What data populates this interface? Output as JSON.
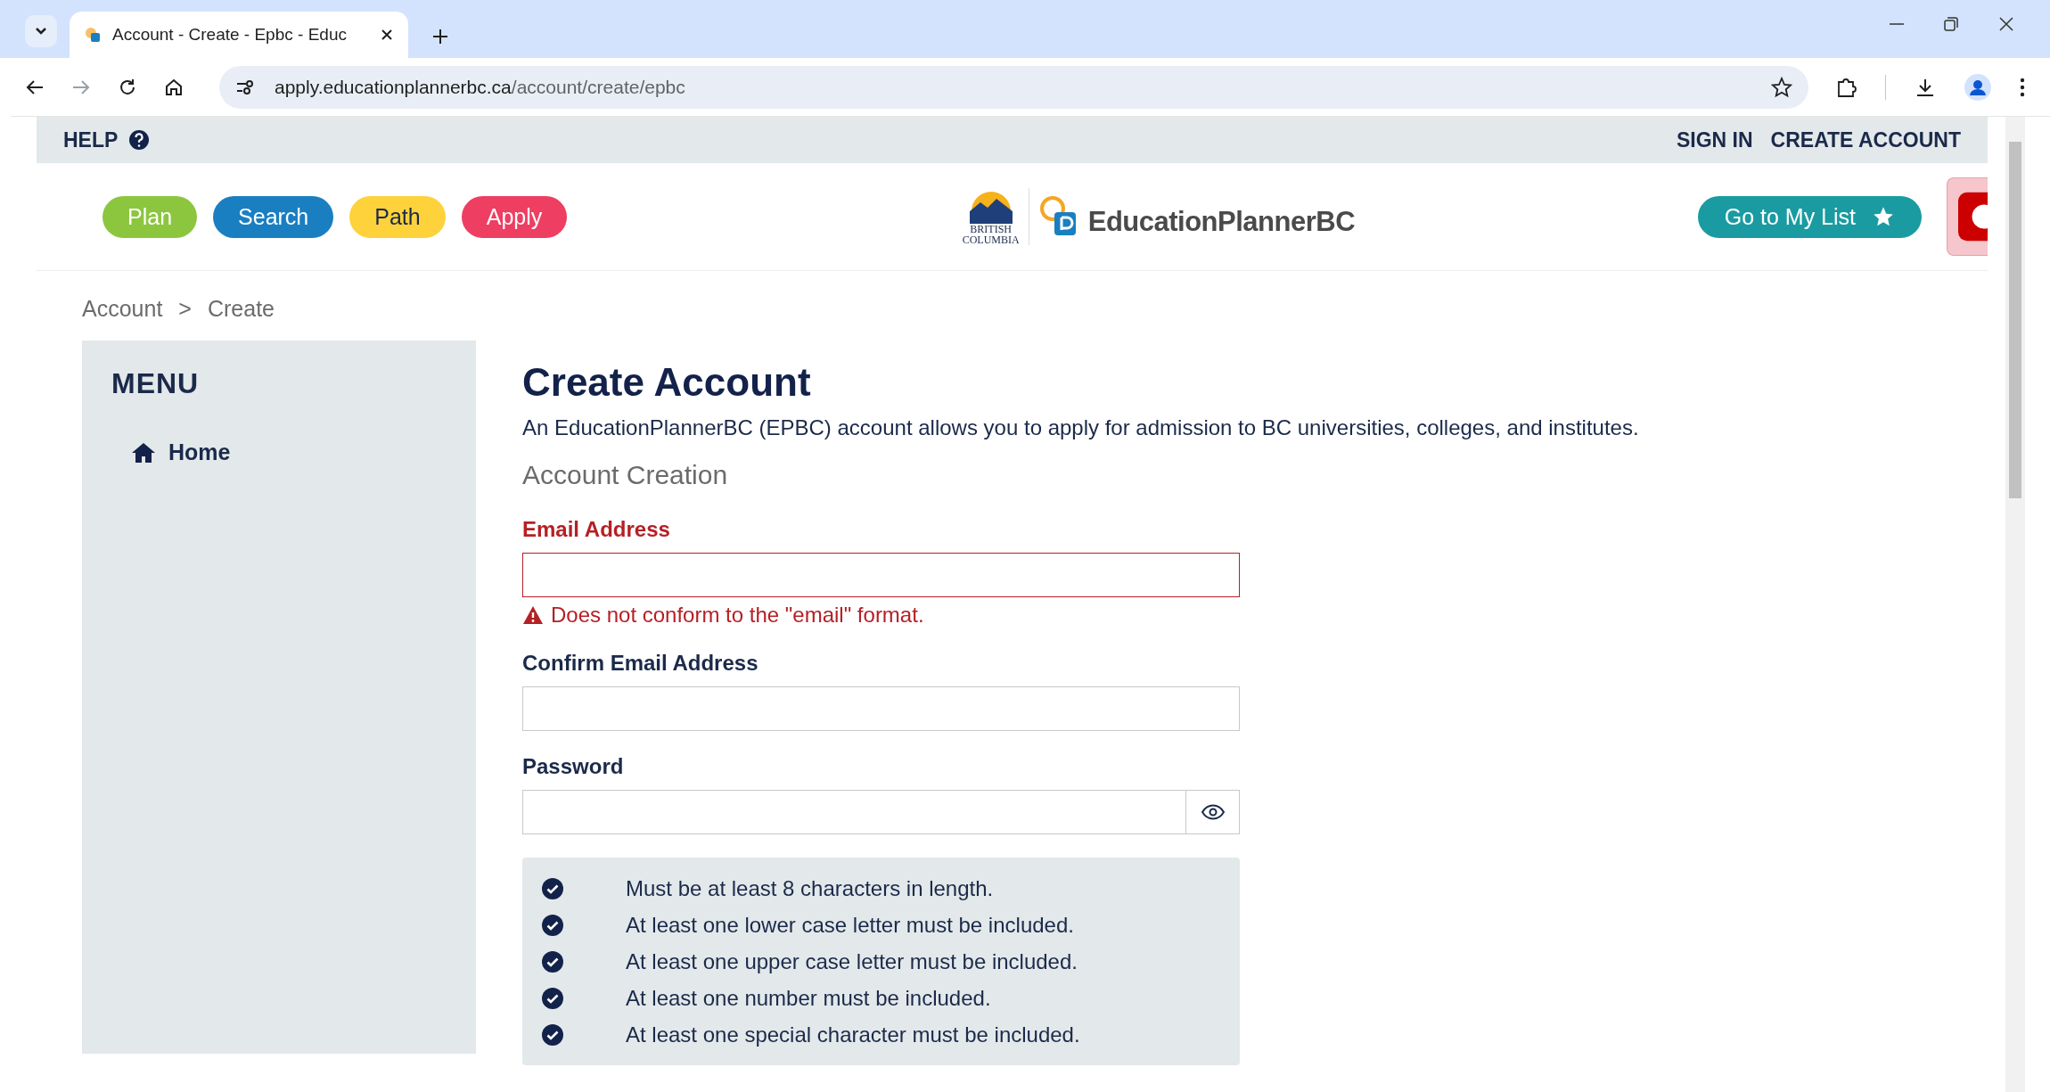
{
  "browser": {
    "tab_title": "Account - Create - Epbc - Educ",
    "url_host": "apply.educationplannerbc.ca",
    "url_path": "/account/create/epbc"
  },
  "top_bar": {
    "help": "HELP",
    "links": [
      "SIGN IN",
      "CREATE ACCOUNT"
    ]
  },
  "nav": [
    {
      "label": "Plan",
      "color": "#8cc63f"
    },
    {
      "label": "Search",
      "color": "#1a7fc1"
    },
    {
      "label": "Path",
      "color": "#fdd23b"
    },
    {
      "label": "Apply",
      "color": "#ee3e62"
    }
  ],
  "logo": {
    "province_line1": "BRITISH",
    "province_line2": "COLUMBIA",
    "name": "EducationPlannerBC"
  },
  "my_list_button": "Go to My List",
  "breadcrumb": {
    "items": [
      "Account",
      "Create"
    ],
    "separator": ">"
  },
  "sidebar": {
    "title": "MENU",
    "items": [
      {
        "label": "Home"
      }
    ]
  },
  "form": {
    "title": "Create Account",
    "description": "An EducationPlannerBC (EPBC) account allows you to apply for admission to BC universities, colleges, and institutes.",
    "section": "Account Creation",
    "fields": [
      {
        "label": "Email Address",
        "kind": "text",
        "invalid": true,
        "error": "Does not conform to the \"email\" format."
      },
      {
        "label": "Confirm Email Address",
        "kind": "text",
        "invalid": false
      },
      {
        "label": "Password",
        "kind": "password",
        "invalid": false
      }
    ],
    "requirements": [
      {
        "text": "Must be at least 8 characters in length.",
        "met": true
      },
      {
        "text": "At least one lower case letter must be included.",
        "met": true
      },
      {
        "text": "At least one upper case letter must be included.",
        "met": true
      },
      {
        "text": "At least one number must be included.",
        "met": true
      },
      {
        "text": "At least one special character must be included.",
        "met": true
      }
    ]
  }
}
